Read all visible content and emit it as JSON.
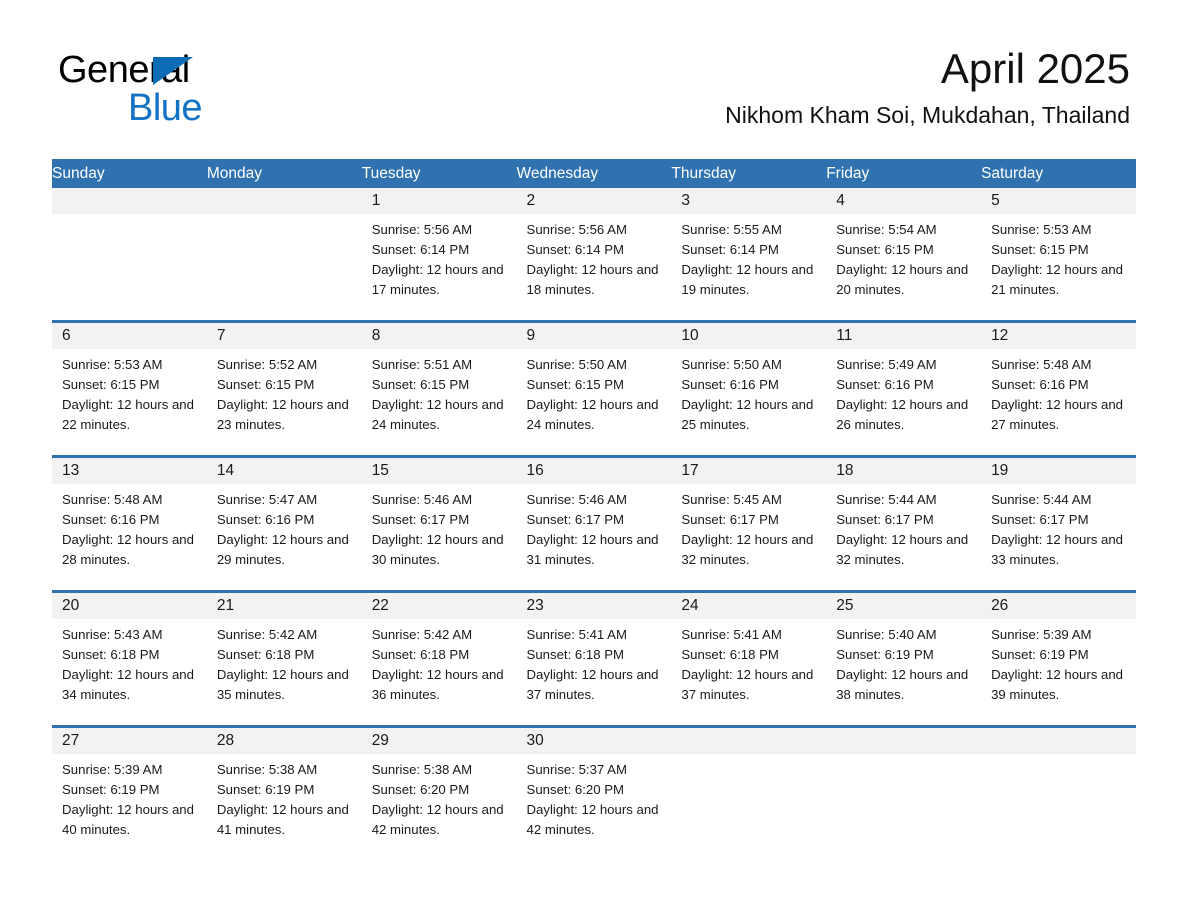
{
  "brand": {
    "line1": "General",
    "line2": "Blue",
    "triangle_color": "#0a6cb5",
    "text_color": "#1272c4"
  },
  "header": {
    "title": "April 2025",
    "subtitle": "Nikhom Kham Soi, Mukdahan, Thailand"
  },
  "theme": {
    "header_blue": "#3071af",
    "daynum_band": "#f2f2f2",
    "separator_blue": "#3071af"
  },
  "calendar": {
    "weekday_headers": [
      "Sunday",
      "Monday",
      "Tuesday",
      "Wednesday",
      "Thursday",
      "Friday",
      "Saturday"
    ],
    "weeks": [
      [
        {
          "day": "",
          "sunrise": "",
          "sunset": "",
          "daylight": ""
        },
        {
          "day": "",
          "sunrise": "",
          "sunset": "",
          "daylight": ""
        },
        {
          "day": "1",
          "sunrise": "Sunrise: 5:56 AM",
          "sunset": "Sunset: 6:14 PM",
          "daylight": "Daylight: 12 hours and 17 minutes."
        },
        {
          "day": "2",
          "sunrise": "Sunrise: 5:56 AM",
          "sunset": "Sunset: 6:14 PM",
          "daylight": "Daylight: 12 hours and 18 minutes."
        },
        {
          "day": "3",
          "sunrise": "Sunrise: 5:55 AM",
          "sunset": "Sunset: 6:14 PM",
          "daylight": "Daylight: 12 hours and 19 minutes."
        },
        {
          "day": "4",
          "sunrise": "Sunrise: 5:54 AM",
          "sunset": "Sunset: 6:15 PM",
          "daylight": "Daylight: 12 hours and 20 minutes."
        },
        {
          "day": "5",
          "sunrise": "Sunrise: 5:53 AM",
          "sunset": "Sunset: 6:15 PM",
          "daylight": "Daylight: 12 hours and 21 minutes."
        }
      ],
      [
        {
          "day": "6",
          "sunrise": "Sunrise: 5:53 AM",
          "sunset": "Sunset: 6:15 PM",
          "daylight": "Daylight: 12 hours and 22 minutes."
        },
        {
          "day": "7",
          "sunrise": "Sunrise: 5:52 AM",
          "sunset": "Sunset: 6:15 PM",
          "daylight": "Daylight: 12 hours and 23 minutes."
        },
        {
          "day": "8",
          "sunrise": "Sunrise: 5:51 AM",
          "sunset": "Sunset: 6:15 PM",
          "daylight": "Daylight: 12 hours and 24 minutes."
        },
        {
          "day": "9",
          "sunrise": "Sunrise: 5:50 AM",
          "sunset": "Sunset: 6:15 PM",
          "daylight": "Daylight: 12 hours and 24 minutes."
        },
        {
          "day": "10",
          "sunrise": "Sunrise: 5:50 AM",
          "sunset": "Sunset: 6:16 PM",
          "daylight": "Daylight: 12 hours and 25 minutes."
        },
        {
          "day": "11",
          "sunrise": "Sunrise: 5:49 AM",
          "sunset": "Sunset: 6:16 PM",
          "daylight": "Daylight: 12 hours and 26 minutes."
        },
        {
          "day": "12",
          "sunrise": "Sunrise: 5:48 AM",
          "sunset": "Sunset: 6:16 PM",
          "daylight": "Daylight: 12 hours and 27 minutes."
        }
      ],
      [
        {
          "day": "13",
          "sunrise": "Sunrise: 5:48 AM",
          "sunset": "Sunset: 6:16 PM",
          "daylight": "Daylight: 12 hours and 28 minutes."
        },
        {
          "day": "14",
          "sunrise": "Sunrise: 5:47 AM",
          "sunset": "Sunset: 6:16 PM",
          "daylight": "Daylight: 12 hours and 29 minutes."
        },
        {
          "day": "15",
          "sunrise": "Sunrise: 5:46 AM",
          "sunset": "Sunset: 6:17 PM",
          "daylight": "Daylight: 12 hours and 30 minutes."
        },
        {
          "day": "16",
          "sunrise": "Sunrise: 5:46 AM",
          "sunset": "Sunset: 6:17 PM",
          "daylight": "Daylight: 12 hours and 31 minutes."
        },
        {
          "day": "17",
          "sunrise": "Sunrise: 5:45 AM",
          "sunset": "Sunset: 6:17 PM",
          "daylight": "Daylight: 12 hours and 32 minutes."
        },
        {
          "day": "18",
          "sunrise": "Sunrise: 5:44 AM",
          "sunset": "Sunset: 6:17 PM",
          "daylight": "Daylight: 12 hours and 32 minutes."
        },
        {
          "day": "19",
          "sunrise": "Sunrise: 5:44 AM",
          "sunset": "Sunset: 6:17 PM",
          "daylight": "Daylight: 12 hours and 33 minutes."
        }
      ],
      [
        {
          "day": "20",
          "sunrise": "Sunrise: 5:43 AM",
          "sunset": "Sunset: 6:18 PM",
          "daylight": "Daylight: 12 hours and 34 minutes."
        },
        {
          "day": "21",
          "sunrise": "Sunrise: 5:42 AM",
          "sunset": "Sunset: 6:18 PM",
          "daylight": "Daylight: 12 hours and 35 minutes."
        },
        {
          "day": "22",
          "sunrise": "Sunrise: 5:42 AM",
          "sunset": "Sunset: 6:18 PM",
          "daylight": "Daylight: 12 hours and 36 minutes."
        },
        {
          "day": "23",
          "sunrise": "Sunrise: 5:41 AM",
          "sunset": "Sunset: 6:18 PM",
          "daylight": "Daylight: 12 hours and 37 minutes."
        },
        {
          "day": "24",
          "sunrise": "Sunrise: 5:41 AM",
          "sunset": "Sunset: 6:18 PM",
          "daylight": "Daylight: 12 hours and 37 minutes."
        },
        {
          "day": "25",
          "sunrise": "Sunrise: 5:40 AM",
          "sunset": "Sunset: 6:19 PM",
          "daylight": "Daylight: 12 hours and 38 minutes."
        },
        {
          "day": "26",
          "sunrise": "Sunrise: 5:39 AM",
          "sunset": "Sunset: 6:19 PM",
          "daylight": "Daylight: 12 hours and 39 minutes."
        }
      ],
      [
        {
          "day": "27",
          "sunrise": "Sunrise: 5:39 AM",
          "sunset": "Sunset: 6:19 PM",
          "daylight": "Daylight: 12 hours and 40 minutes."
        },
        {
          "day": "28",
          "sunrise": "Sunrise: 5:38 AM",
          "sunset": "Sunset: 6:19 PM",
          "daylight": "Daylight: 12 hours and 41 minutes."
        },
        {
          "day": "29",
          "sunrise": "Sunrise: 5:38 AM",
          "sunset": "Sunset: 6:20 PM",
          "daylight": "Daylight: 12 hours and 42 minutes."
        },
        {
          "day": "30",
          "sunrise": "Sunrise: 5:37 AM",
          "sunset": "Sunset: 6:20 PM",
          "daylight": "Daylight: 12 hours and 42 minutes."
        },
        {
          "day": "",
          "sunrise": "",
          "sunset": "",
          "daylight": ""
        },
        {
          "day": "",
          "sunrise": "",
          "sunset": "",
          "daylight": ""
        },
        {
          "day": "",
          "sunrise": "",
          "sunset": "",
          "daylight": ""
        }
      ]
    ]
  }
}
